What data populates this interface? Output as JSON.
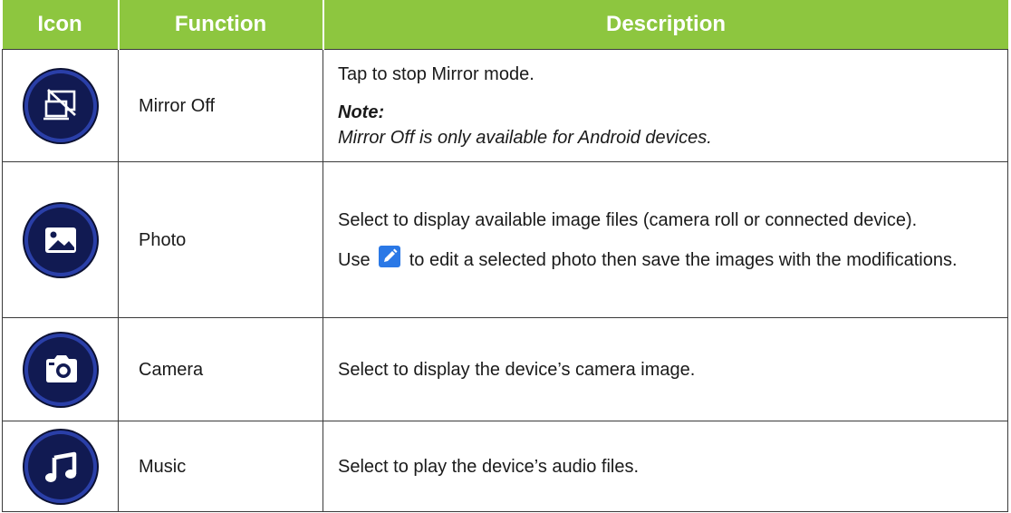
{
  "table": {
    "headers": {
      "icon": "Icon",
      "function": "Function",
      "description": "Description"
    },
    "rows": [
      {
        "icon": "mirror-off-icon",
        "function": "Mirror Off",
        "description": "Tap to stop Mirror mode.",
        "note_label": "Note:",
        "note_text": "Mirror Off is only available for Android devices."
      },
      {
        "icon": "photo-icon",
        "function": "Photo",
        "description": "Select to display available image files (camera roll or connected device).",
        "description_2_before": "Use",
        "description_2_icon": "pencil-edit-icon",
        "description_2_after": "to edit a selected photo then save the images with the modifications."
      },
      {
        "icon": "camera-icon",
        "function": "Camera",
        "description": "Select to display the device’s camera image."
      },
      {
        "icon": "music-note-icon",
        "function": "Music",
        "description": "Select to play the device’s audio files."
      }
    ]
  },
  "colors": {
    "header_bg": "#8dc63f",
    "header_text": "#ffffff",
    "icon_bg": "#111a52",
    "icon_ring": "#2a3fa8",
    "edit_icon_bg": "#2a78e6"
  }
}
